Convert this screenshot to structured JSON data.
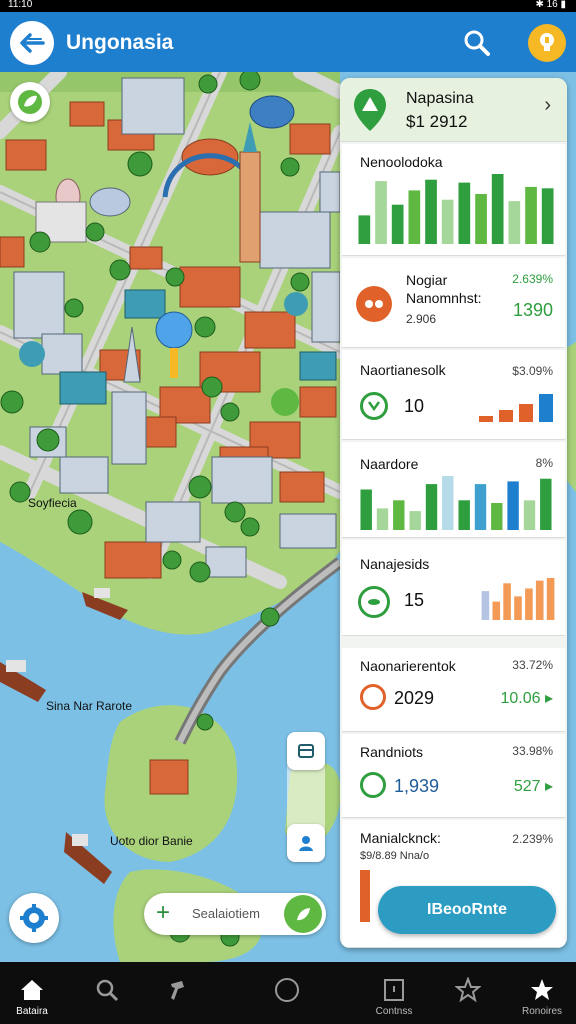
{
  "status_bar": {
    "left_text": "11:10",
    "right_text": "✱ 16 ▮"
  },
  "header": {
    "title": "Ungonasia"
  },
  "map": {
    "labels": [
      "Soyfiecia",
      "Sina Nar Rarote",
      "Uoto dior Banie"
    ]
  },
  "bottom_search": {
    "label": "Sealaiotiem"
  },
  "panel": {
    "header": {
      "name": "Napasina",
      "value": "$1 2912"
    },
    "cards": [
      {
        "title": "Nenoolodoka",
        "chart_data": {
          "type": "bar",
          "values": [
            40,
            88,
            55,
            75,
            90,
            62,
            86,
            70,
            98,
            60,
            80,
            78
          ],
          "colors": [
            "#2e9e3e",
            "#a5d79a",
            "#2e9e3e",
            "#5fb842",
            "#2e9e3e",
            "#a5d79a",
            "#2e9e3e",
            "#5fb842",
            "#2e9e3e",
            "#a5d79a",
            "#5fb842",
            "#2e9e3e"
          ]
        }
      },
      {
        "title": "Nogiar",
        "subtitle": "Nanomnhst:",
        "small_value": "2.906",
        "pct": "2.639%",
        "big_value": "1390"
      },
      {
        "title": "Naortianesolk",
        "pct": "$3.09%",
        "big_value": "10",
        "chart_data": {
          "type": "bar",
          "values": [
            15,
            30,
            45,
            70
          ],
          "colors": [
            "#e0622a",
            "#e0622a",
            "#e0622a",
            "#1f7fcf"
          ]
        }
      },
      {
        "title": "Naardore",
        "pct": "8%",
        "chart_data": {
          "type": "bar",
          "values": [
            75,
            40,
            55,
            35,
            85,
            100,
            55,
            85,
            50,
            90,
            55,
            95
          ],
          "colors": [
            "#2e9e3e",
            "#a5d79a",
            "#5fb842",
            "#a5d79a",
            "#2e9e3e",
            "#b5dbe8",
            "#2e9e3e",
            "#3fa0d0",
            "#5fb842",
            "#1f7fcf",
            "#a5d79a",
            "#2e9e3e"
          ]
        }
      },
      {
        "title": "Nanajesids",
        "big_value": "15",
        "chart_data": {
          "type": "bar",
          "values": [
            55,
            35,
            70,
            45,
            60,
            75,
            80
          ],
          "colors": [
            "#b5c4e3",
            "#f29a56",
            "#f29a56",
            "#f29a56",
            "#f29a56",
            "#f29a56",
            "#f29a56"
          ]
        }
      },
      {
        "title": "Naonarierentok",
        "pct": "33.72%",
        "big_value": "2029",
        "side_value": "10.06 ▸"
      },
      {
        "title": "Randniots",
        "pct": "33.98%",
        "big_value": "1,939",
        "side_value": "527 ▸"
      },
      {
        "title": "Manialcknck:",
        "subtitle": "$9/8.89 Nna/o",
        "pct": "2.239%"
      }
    ]
  },
  "cta": {
    "label": "IBeooRnte"
  },
  "bottom_nav": [
    {
      "label": "Bataira",
      "icon": "home-icon",
      "active": true
    },
    {
      "label": "",
      "icon": "search-icon"
    },
    {
      "label": "",
      "icon": "hammer-icon"
    },
    {
      "label": "",
      "icon": "circle-icon"
    },
    {
      "label": "Contnss",
      "icon": "square-icon"
    },
    {
      "label": "",
      "icon": "star-outline-icon"
    },
    {
      "label": "Ronoires",
      "icon": "star-icon"
    }
  ],
  "colors": {
    "primary": "#1f7fcf",
    "accent_green": "#2e9e3e",
    "accent_orange": "#e0622a",
    "water": "#7cc0e6",
    "land": "#a9d27a"
  }
}
